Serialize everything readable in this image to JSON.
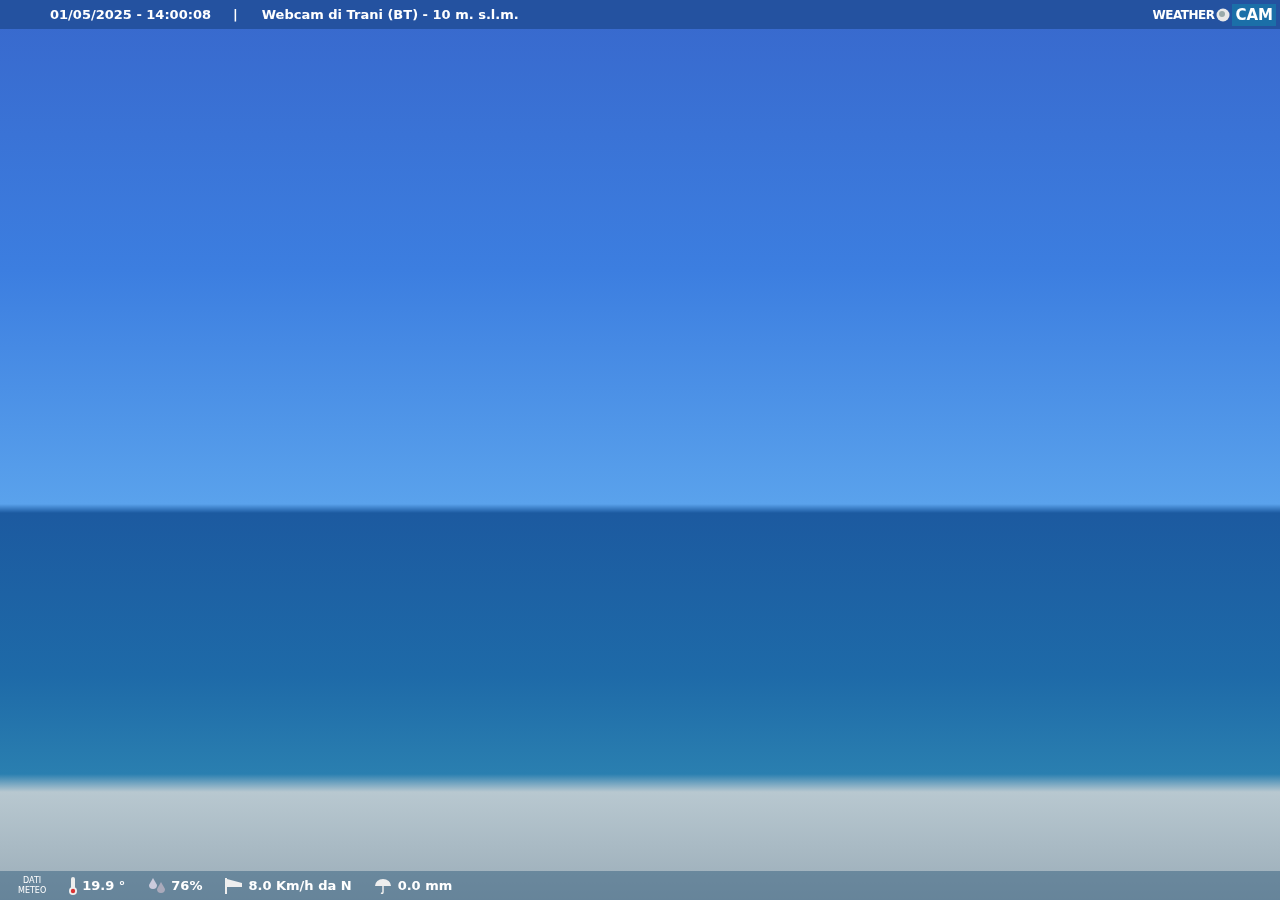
{
  "header": {
    "datetime": "01/05/2025 - 14:00:08",
    "separator": "|",
    "title": "Webcam di Trani (BT) - 10 m. s.l.m.",
    "logo": {
      "word": "WEATHER",
      "badge": "CAM"
    }
  },
  "weather_bar": {
    "label_line_1": "DATI",
    "label_line_2": "METEO",
    "readings": [
      {
        "kind": "temperature",
        "value": "19.9 °"
      },
      {
        "kind": "humidity",
        "value": "76%"
      },
      {
        "kind": "wind",
        "value": "8.0 Km/h da N"
      },
      {
        "kind": "rain",
        "value": "0.0 mm"
      }
    ]
  }
}
